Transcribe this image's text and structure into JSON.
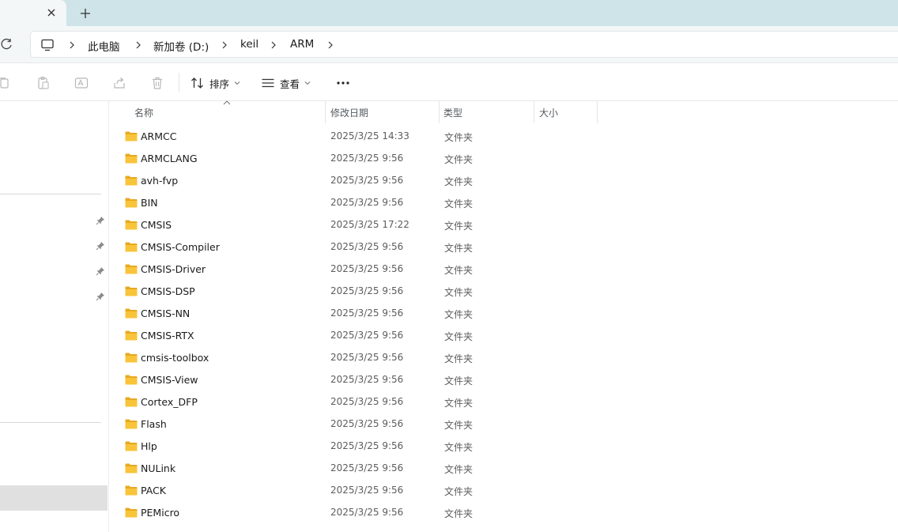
{
  "tab": {
    "close_glyph": "✕",
    "new_tab_glyph": "+"
  },
  "breadcrumb": [
    "此电脑",
    "新加卷 (D:)",
    "keil",
    "ARM"
  ],
  "toolbar": {
    "sort_label": "排序",
    "view_label": "查看",
    "more_glyph": "···"
  },
  "columns": {
    "name": "名称",
    "modified": "修改日期",
    "type": "类型",
    "size": "大小"
  },
  "files": [
    {
      "name": "ARMCC",
      "date": "2025/3/25 14:33",
      "type": "文件夹"
    },
    {
      "name": "ARMCLANG",
      "date": "2025/3/25 9:56",
      "type": "文件夹"
    },
    {
      "name": "avh-fvp",
      "date": "2025/3/25 9:56",
      "type": "文件夹"
    },
    {
      "name": "BIN",
      "date": "2025/3/25 9:56",
      "type": "文件夹"
    },
    {
      "name": "CMSIS",
      "date": "2025/3/25 17:22",
      "type": "文件夹"
    },
    {
      "name": "CMSIS-Compiler",
      "date": "2025/3/25 9:56",
      "type": "文件夹"
    },
    {
      "name": "CMSIS-Driver",
      "date": "2025/3/25 9:56",
      "type": "文件夹"
    },
    {
      "name": "CMSIS-DSP",
      "date": "2025/3/25 9:56",
      "type": "文件夹"
    },
    {
      "name": "CMSIS-NN",
      "date": "2025/3/25 9:56",
      "type": "文件夹"
    },
    {
      "name": "CMSIS-RTX",
      "date": "2025/3/25 9:56",
      "type": "文件夹"
    },
    {
      "name": "cmsis-toolbox",
      "date": "2025/3/25 9:56",
      "type": "文件夹"
    },
    {
      "name": "CMSIS-View",
      "date": "2025/3/25 9:56",
      "type": "文件夹"
    },
    {
      "name": "Cortex_DFP",
      "date": "2025/3/25 9:56",
      "type": "文件夹"
    },
    {
      "name": "Flash",
      "date": "2025/3/25 9:56",
      "type": "文件夹"
    },
    {
      "name": "Hlp",
      "date": "2025/3/25 9:56",
      "type": "文件夹"
    },
    {
      "name": "NULink",
      "date": "2025/3/25 9:56",
      "type": "文件夹"
    },
    {
      "name": "PACK",
      "date": "2025/3/25 9:56",
      "type": "文件夹"
    },
    {
      "name": "PEMicro",
      "date": "2025/3/25 9:56",
      "type": "文件夹"
    }
  ],
  "icons": {
    "folder": "folder-icon",
    "pc": "this-pc-icon",
    "pin": "pin-icon"
  },
  "colors": {
    "folder_yellow": "#f8c43a",
    "folder_dark": "#e8a920",
    "tabstrip_bg": "#cfe4e8",
    "selected_nav": "#e0e0e0"
  }
}
